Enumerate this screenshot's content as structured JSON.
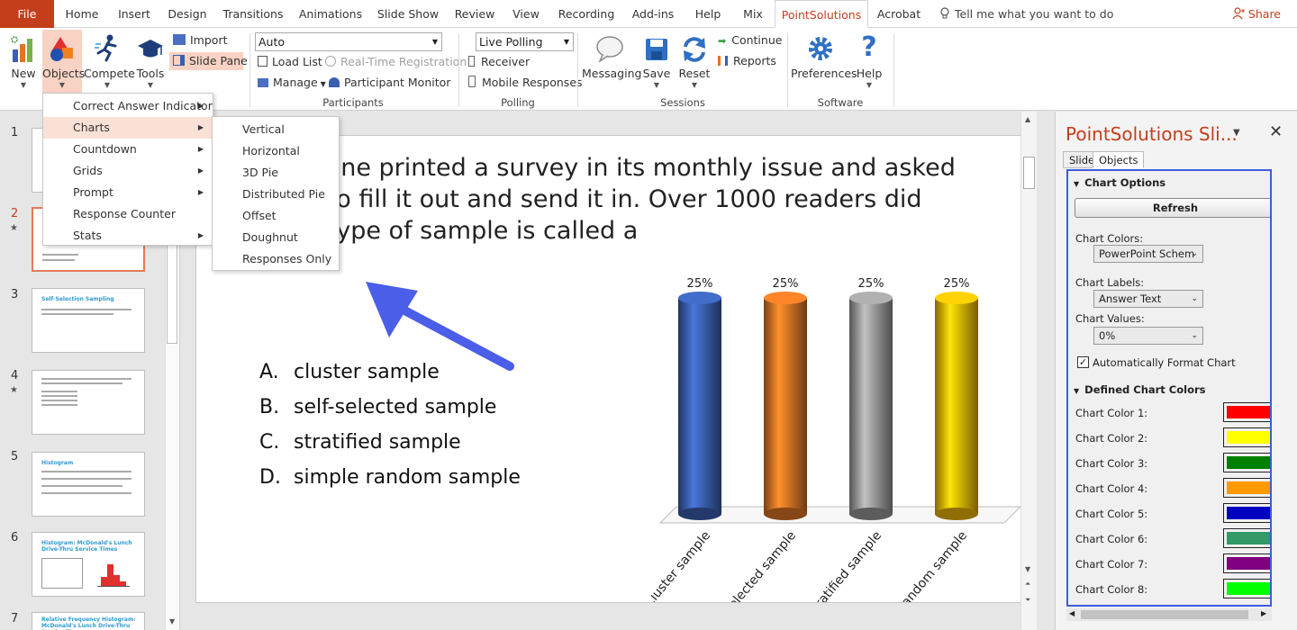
{
  "tabs": [
    "File",
    "Home",
    "Insert",
    "Design",
    "Transitions",
    "Animations",
    "Slide Show",
    "Review",
    "View",
    "Recording",
    "Add-ins",
    "Help",
    "Mix",
    "PointSolutions",
    "Acrobat"
  ],
  "tell_me": "Tell me what you want to do",
  "share": "Share",
  "ribbon": {
    "new": "New",
    "objects": "Objects",
    "compete": "Compete",
    "tools": "Tools",
    "import": "Import",
    "slide_pane": "Slide Pane",
    "participant_combo": "Auto",
    "load_list": "Load List",
    "real_time_registration": "Real-Time Registration",
    "manage": "Manage",
    "participant_monitor": "Participant Monitor",
    "group_participants": "Participants",
    "polling_combo": "Live Polling",
    "receiver": "Receiver",
    "mobile_responses": "Mobile Responses",
    "group_polling": "Polling",
    "messaging": "Messaging",
    "save": "Save",
    "reset": "Reset",
    "continue": "Continue",
    "reports": "Reports",
    "group_sessions": "Sessions",
    "preferences": "Preferences",
    "help": "Help",
    "group_software": "Software"
  },
  "objects_menu": [
    "Correct Answer Indicator",
    "Charts",
    "Countdown",
    "Grids",
    "Prompt",
    "Response Counter",
    "Stats"
  ],
  "charts_menu": [
    "Vertical",
    "Horizontal",
    "3D Pie",
    "Distributed Pie",
    "Offset",
    "Doughnut",
    "Responses Only"
  ],
  "thumbnails": {
    "numbers": [
      "1",
      "2",
      "3",
      "4",
      "5",
      "6",
      "7"
    ],
    "slide3_title": "Self-Selection Sampling",
    "slide5_title": "Histogram",
    "slide6_title": "Histogram: McDonald's Lunch Drive-Thru Service Times",
    "slide7_title": "Relative Frequency Histogram: McDonald's Lunch Drive-Thru Service Times"
  },
  "slide": {
    "question_lines": [
      "azine printed a survey in its monthly issue and asked",
      "s to fill it out and send it in. Over 1000 readers did",
      "s type of sample is called a"
    ],
    "answers": [
      {
        "letter": "A.",
        "text": "cluster sample"
      },
      {
        "letter": "B.",
        "text": "self-selected sample"
      },
      {
        "letter": "C.",
        "text": "stratified sample"
      },
      {
        "letter": "D.",
        "text": "simple random sample"
      }
    ]
  },
  "chart_data": {
    "type": "bar",
    "categories": [
      "cluster sample",
      "self-selected sample",
      "stratified sample",
      "simple random sample"
    ],
    "values": [
      25,
      25,
      25,
      25
    ],
    "value_labels": [
      "25%",
      "25%",
      "25%",
      "25%"
    ],
    "colors": [
      "#3a5fb0",
      "#e07424",
      "#9a9a9a",
      "#f2b705"
    ],
    "ylim": [
      0,
      25
    ]
  },
  "pane": {
    "title": "PointSolutions Sli...",
    "tab_slide": "Slide",
    "tab_objects": "Objects",
    "chart_options": "Chart Options",
    "refresh": "Refresh",
    "chart_colors_label": "Chart Colors:",
    "chart_colors_value": "PowerPoint Schem",
    "chart_labels_label": "Chart Labels:",
    "chart_labels_value": "Answer Text",
    "chart_values_label": "Chart Values:",
    "chart_values_value": "0%",
    "auto_format": "Automatically Format Chart",
    "defined_colors": "Defined Chart Colors",
    "colors": [
      {
        "label": "Chart Color 1:",
        "hex": "#ff0000"
      },
      {
        "label": "Chart Color 2:",
        "hex": "#ffff00"
      },
      {
        "label": "Chart Color 3:",
        "hex": "#008000"
      },
      {
        "label": "Chart Color 4:",
        "hex": "#ff9900"
      },
      {
        "label": "Chart Color 5:",
        "hex": "#0000c0"
      },
      {
        "label": "Chart Color 6:",
        "hex": "#339966"
      },
      {
        "label": "Chart Color 7:",
        "hex": "#800080"
      },
      {
        "label": "Chart Color 8:",
        "hex": "#00ff00"
      }
    ]
  }
}
